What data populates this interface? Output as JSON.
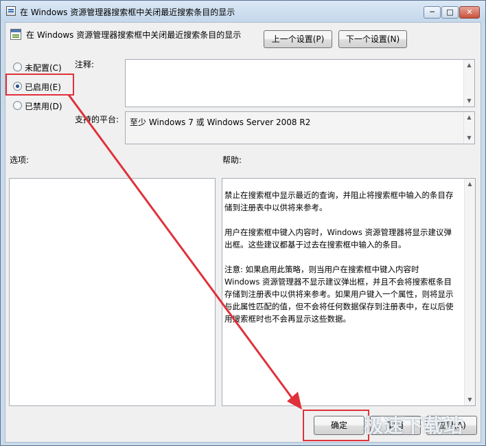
{
  "window": {
    "title": "在 Windows 资源管理器搜索框中关闭最近搜索条目的显示",
    "minimize": "─",
    "maximize": "□",
    "close": "✕"
  },
  "header": {
    "policy_title": "在 Windows 资源管理器搜索框中关闭最近搜索条目的显示",
    "prev_button": "上一个设置(P)",
    "next_button": "下一个设置(N)"
  },
  "state": {
    "options": [
      {
        "label": "未配置(C)",
        "selected": false
      },
      {
        "label": "已启用(E)",
        "selected": true
      },
      {
        "label": "已禁用(D)",
        "selected": false
      }
    ]
  },
  "comment": {
    "label": "注释:",
    "value": ""
  },
  "platform": {
    "label": "支持的平台:",
    "value": "至少 Windows 7 或 Windows Server 2008 R2"
  },
  "options_panel": {
    "label": "选项:"
  },
  "help_panel": {
    "label": "帮助:",
    "paragraphs": [
      "禁止在搜索框中显示最近的查询，并阻止将搜索框中输入的条目存\n储到注册表中以供将来参考。",
      "用户在搜索框中键入内容时，Windows 资源管理器将显示建议弹\n出框。这些建议都基于过去在搜索框中输入的条目。",
      "注意: 如果启用此策略，则当用户在搜索框中键入内容时\nWindows 资源管理器不显示建议弹出框，并且不会将搜索框条目\n存储到注册表中以供将来参考。如果用户键入一个属性，则将显示\n与此属性匹配的值，但不会将任何数据保存到注册表中，在以后使\n用搜索框时也不会再显示这些数据。"
    ]
  },
  "footer": {
    "ok_button": "确定",
    "cancel_button": "取消",
    "apply_button": "应用(A)"
  },
  "watermark": "极速下载站",
  "colors": {
    "annotation": "#e0303a",
    "title_bg": "#c9daea"
  }
}
